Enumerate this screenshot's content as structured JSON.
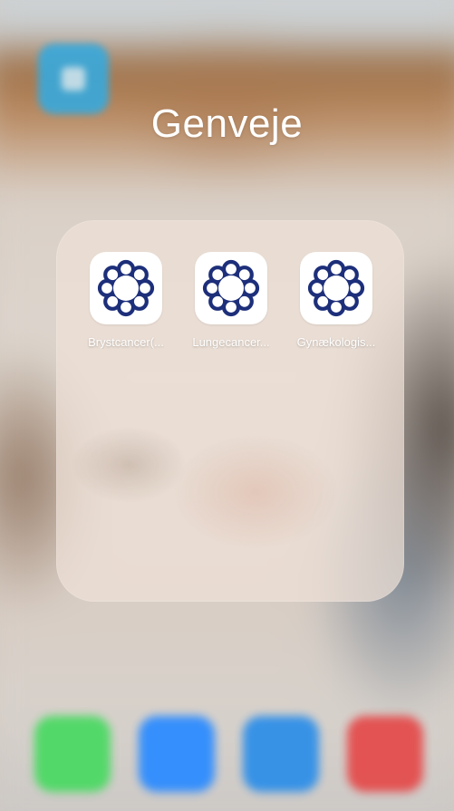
{
  "folder": {
    "title": "Genveje"
  },
  "apps": [
    {
      "label": "Brystcancer(...",
      "icon": "rosette-logo-icon"
    },
    {
      "label": "Lungecancer...",
      "icon": "rosette-logo-icon"
    },
    {
      "label": "Gynækologis...",
      "icon": "rosette-logo-icon"
    }
  ],
  "dock": [
    {
      "icon": "phone-icon",
      "color": "#4cd964"
    },
    {
      "icon": "zoom-video-icon",
      "color": "#2d8cff"
    },
    {
      "icon": "safari-icon",
      "color": "#2f8fe8"
    },
    {
      "icon": "todoist-icon",
      "color": "#e44d4d"
    }
  ],
  "colors": {
    "logo_blue": "#1d2f7a",
    "folder_background": "#eee1d7"
  }
}
